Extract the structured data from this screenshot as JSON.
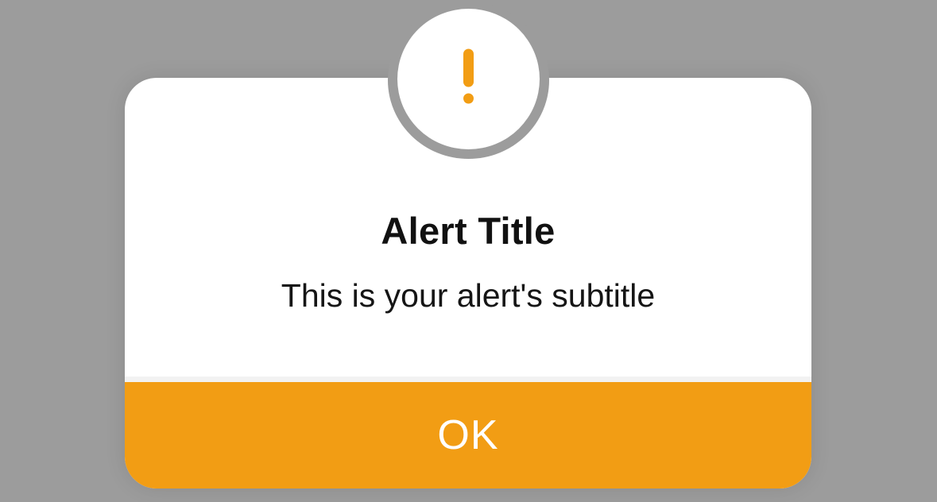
{
  "alert": {
    "title": "Alert Title",
    "subtitle": "This is your alert's subtitle",
    "ok_label": "OK",
    "icon": "exclamation-icon"
  },
  "colors": {
    "backdrop": "#9c9c9c",
    "card": "#ffffff",
    "accent": "#f29d14",
    "title_text": "#111111",
    "button_text": "#ffffff"
  }
}
